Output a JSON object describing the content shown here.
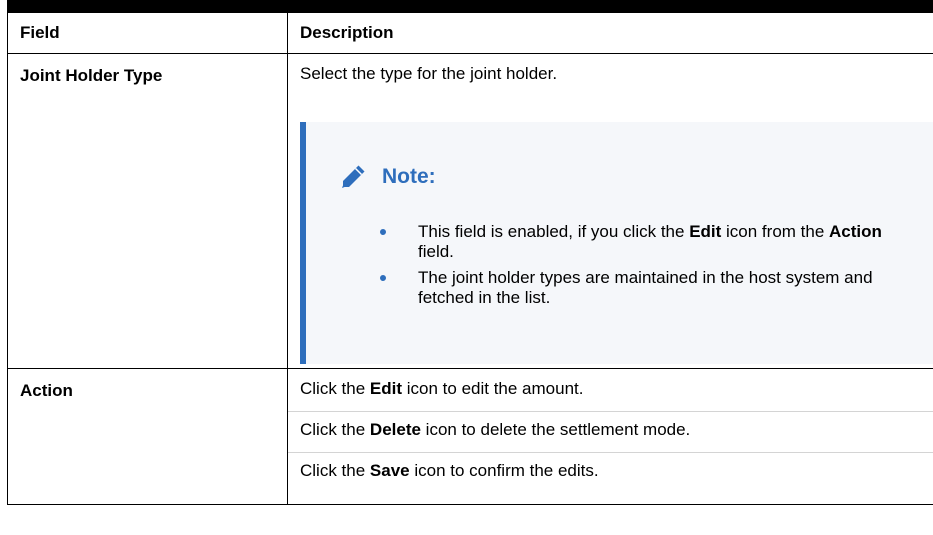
{
  "table": {
    "headers": {
      "field": "Field",
      "description": "Description"
    },
    "rows": [
      {
        "field": "Joint Holder Type",
        "description": "Select the type for the joint holder.",
        "note": {
          "icon": "pencil-icon",
          "title": "Note:",
          "items": [
            {
              "pre": "This field is enabled, if you click the ",
              "b1": "Edit",
              "mid": " icon from the ",
              "b2": "Action",
              "post": " field."
            },
            {
              "text": "The joint holder types are maintained in the host system and fetched in the list."
            }
          ]
        }
      },
      {
        "field": "Action",
        "lines": [
          {
            "pre": "Click the ",
            "bold": "Edit",
            "post": " icon to edit the amount."
          },
          {
            "pre": "Click the ",
            "bold": "Delete",
            "post": " icon to delete the settlement mode."
          },
          {
            "pre": "Click the ",
            "bold": "Save",
            "post": " icon to confirm the edits."
          }
        ]
      }
    ]
  },
  "colors": {
    "accent": "#2e6ebc",
    "note_bg": "#f5f7fa",
    "border": "#000000"
  }
}
